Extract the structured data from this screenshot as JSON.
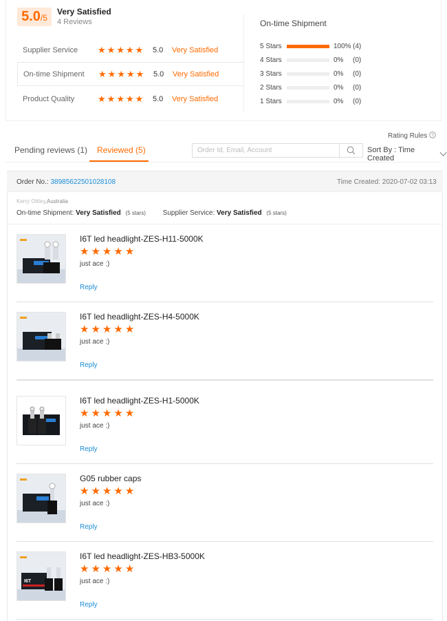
{
  "summary": {
    "score_big": "5.0",
    "score_small": "/5",
    "title": "Very Satisfied",
    "reviews": "4 Reviews",
    "dimensions": [
      {
        "label": "Supplier Service",
        "stars": 5,
        "value": "5.0",
        "text": "Very Satisfied"
      },
      {
        "label": "On-time Shipment",
        "stars": 5,
        "value": "5.0",
        "text": "Very Satisfied"
      },
      {
        "label": "Product Quality",
        "stars": 5,
        "value": "5.0",
        "text": "Very Satisfied"
      }
    ],
    "distribution_title": "On-time Shipment",
    "distribution": [
      {
        "label": "5 Stars",
        "fraction": 1.0,
        "percent": "100%",
        "count": "(4)"
      },
      {
        "label": "4 Stars",
        "fraction": 0,
        "percent": "0%",
        "count": "(0)"
      },
      {
        "label": "3 Stars",
        "fraction": 0,
        "percent": "0%",
        "count": "(0)"
      },
      {
        "label": "2 Stars",
        "fraction": 0,
        "percent": "0%",
        "count": "(0)"
      },
      {
        "label": "1 Stars",
        "fraction": 0,
        "percent": "0%",
        "count": "(0)"
      }
    ]
  },
  "tabs": {
    "rating_rules": "Rating Rules",
    "pending": "Pending reviews (1)",
    "reviewed": "Reviewed (5)",
    "search_placeholder": "Order Id, Email, Account",
    "sort_by": "Sort By : Time Created"
  },
  "order": {
    "order_no_label": "Order No.:",
    "order_no": "38985622501028108",
    "time_created": "Time Created: 2020-07-02 03:13",
    "buyer_name": "Kerry Ottley",
    "buyer_country": ",Australia",
    "shipment_label": "On-time Shipment:",
    "shipment_value": "Very Satisfied",
    "shipment_stars": "(5 stars)",
    "supplier_label": "Supplier Service:",
    "supplier_value": "Very Satisfied",
    "supplier_stars": "(5 stars)"
  },
  "items": [
    {
      "title": "I6T led headlight-ZES-H11-5000K",
      "stars": 5,
      "comment": "just ace :)",
      "reply": "Reply"
    },
    {
      "title": "I6T led headlight-ZES-H4-5000K",
      "stars": 5,
      "comment": "just ace :)",
      "reply": "Reply"
    },
    {
      "title": "I6T led headlight-ZES-H1-5000K",
      "stars": 5,
      "comment": "just ace :)",
      "reply": "Reply"
    },
    {
      "title": "G05 rubber caps",
      "stars": 5,
      "comment": "just ace :)",
      "reply": "Reply"
    },
    {
      "title": "I6T led headlight-ZES-HB3-5000K",
      "stars": 5,
      "comment": "just ace :)",
      "reply": "Reply"
    }
  ],
  "colors": {
    "accent": "#ff6a00",
    "link": "#1a8cd8"
  },
  "icons": {
    "star": "star-icon",
    "search": "search-icon",
    "info": "info-icon",
    "chevron": "chevron-down-icon"
  }
}
